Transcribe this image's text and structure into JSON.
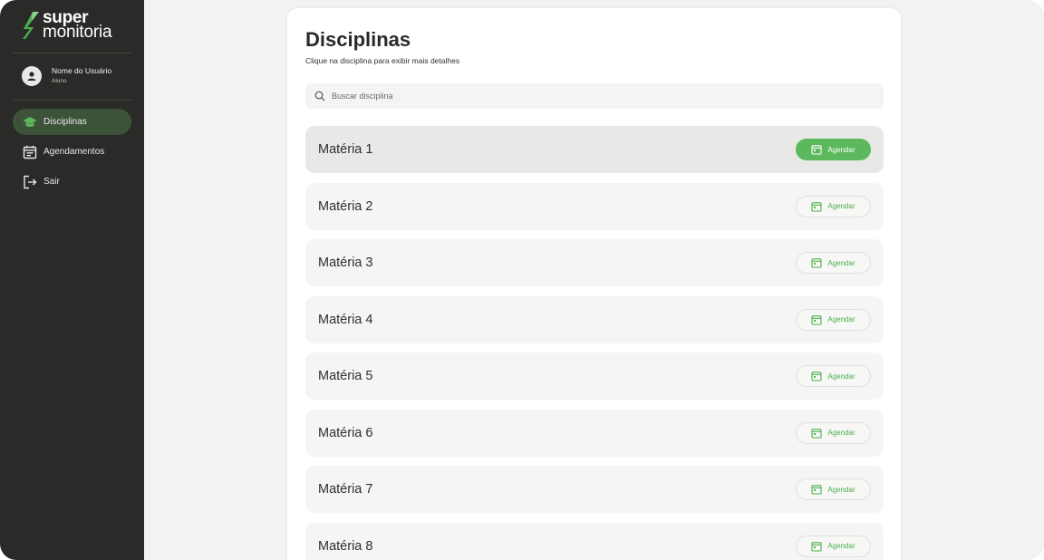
{
  "brand": {
    "line1": "super",
    "line2": "monitoria",
    "accent": "#4caf50"
  },
  "user": {
    "name": "Nome do Usuário",
    "role": "Aluno"
  },
  "nav": [
    {
      "label": "Disciplinas",
      "icon": "graduation-cap-icon",
      "active": true
    },
    {
      "label": "Agendamentos",
      "icon": "calendar-list-icon",
      "active": false
    },
    {
      "label": "Sair",
      "icon": "logout-icon",
      "active": false
    }
  ],
  "main": {
    "title": "Disciplinas",
    "subtitle": "Clique na disciplina para exibir mais detalhes",
    "search_placeholder": "Buscar disciplina",
    "button_label": "Agendar",
    "subjects": [
      {
        "name": "Matéria 1",
        "selected": true
      },
      {
        "name": "Matéria 2",
        "selected": false
      },
      {
        "name": "Matéria 3",
        "selected": false
      },
      {
        "name": "Matéria 4",
        "selected": false
      },
      {
        "name": "Matéria 5",
        "selected": false
      },
      {
        "name": "Matéria 6",
        "selected": false
      },
      {
        "name": "Matéria 7",
        "selected": false
      },
      {
        "name": "Matéria 8",
        "selected": false
      }
    ]
  }
}
